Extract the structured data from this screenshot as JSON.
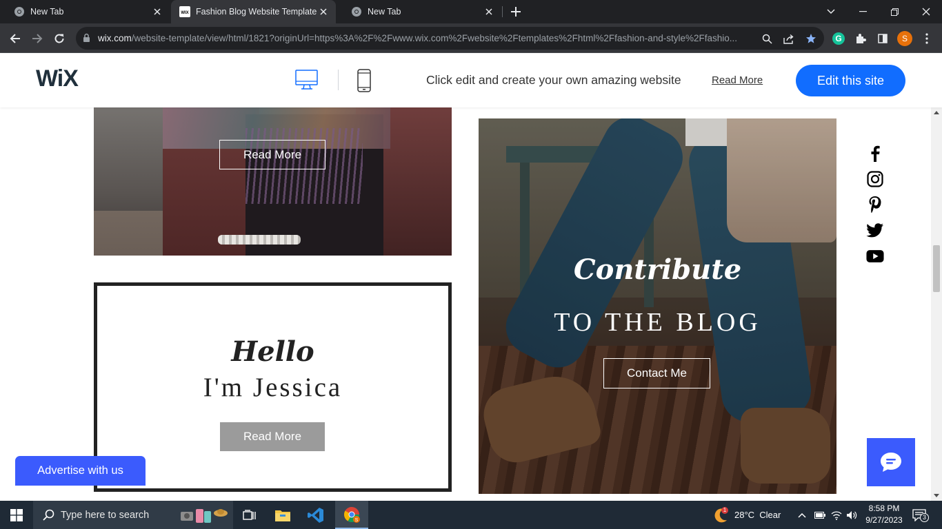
{
  "browser": {
    "tabs": [
      {
        "title": "New Tab",
        "active": false
      },
      {
        "title": "Fashion Blog Website Template |",
        "active": true
      },
      {
        "title": "New Tab",
        "active": false
      }
    ],
    "url_domain": "wix.com",
    "url_rest": "/website-template/view/html/1821?originUrl=https%3A%2F%2Fwww.wix.com%2Fwebsite%2Ftemplates%2Fhtml%2Ffashion-and-style%2Ffashio...",
    "profile_initial": "S"
  },
  "wixbar": {
    "logo": "WiX",
    "message": "Click edit and create your own amazing website",
    "read_more": "Read More",
    "edit_button": "Edit this site"
  },
  "page": {
    "photo1_button": "Read More",
    "hello_script": "Hello",
    "hello_name": "I'm Jessica",
    "hello_button": "Read More",
    "contribute_script": "Contribute",
    "contribute_title": "TO THE BLOG",
    "contact_button": "Contact Me",
    "social": [
      "facebook-icon",
      "instagram-icon",
      "pinterest-icon",
      "twitter-icon",
      "youtube-icon"
    ],
    "advertise": "Advertise with us"
  },
  "taskbar": {
    "search_placeholder": "Type here to search",
    "weather": "28°C  Clear",
    "weather_badge": "1",
    "time": "8:58 PM",
    "date": "9/27/2023",
    "notifications": "3"
  },
  "colors": {
    "wix_blue": "#116dff",
    "advertise_blue": "#3b5bfd",
    "chrome_dark": "#202124",
    "taskbar": "#1f2a36"
  }
}
